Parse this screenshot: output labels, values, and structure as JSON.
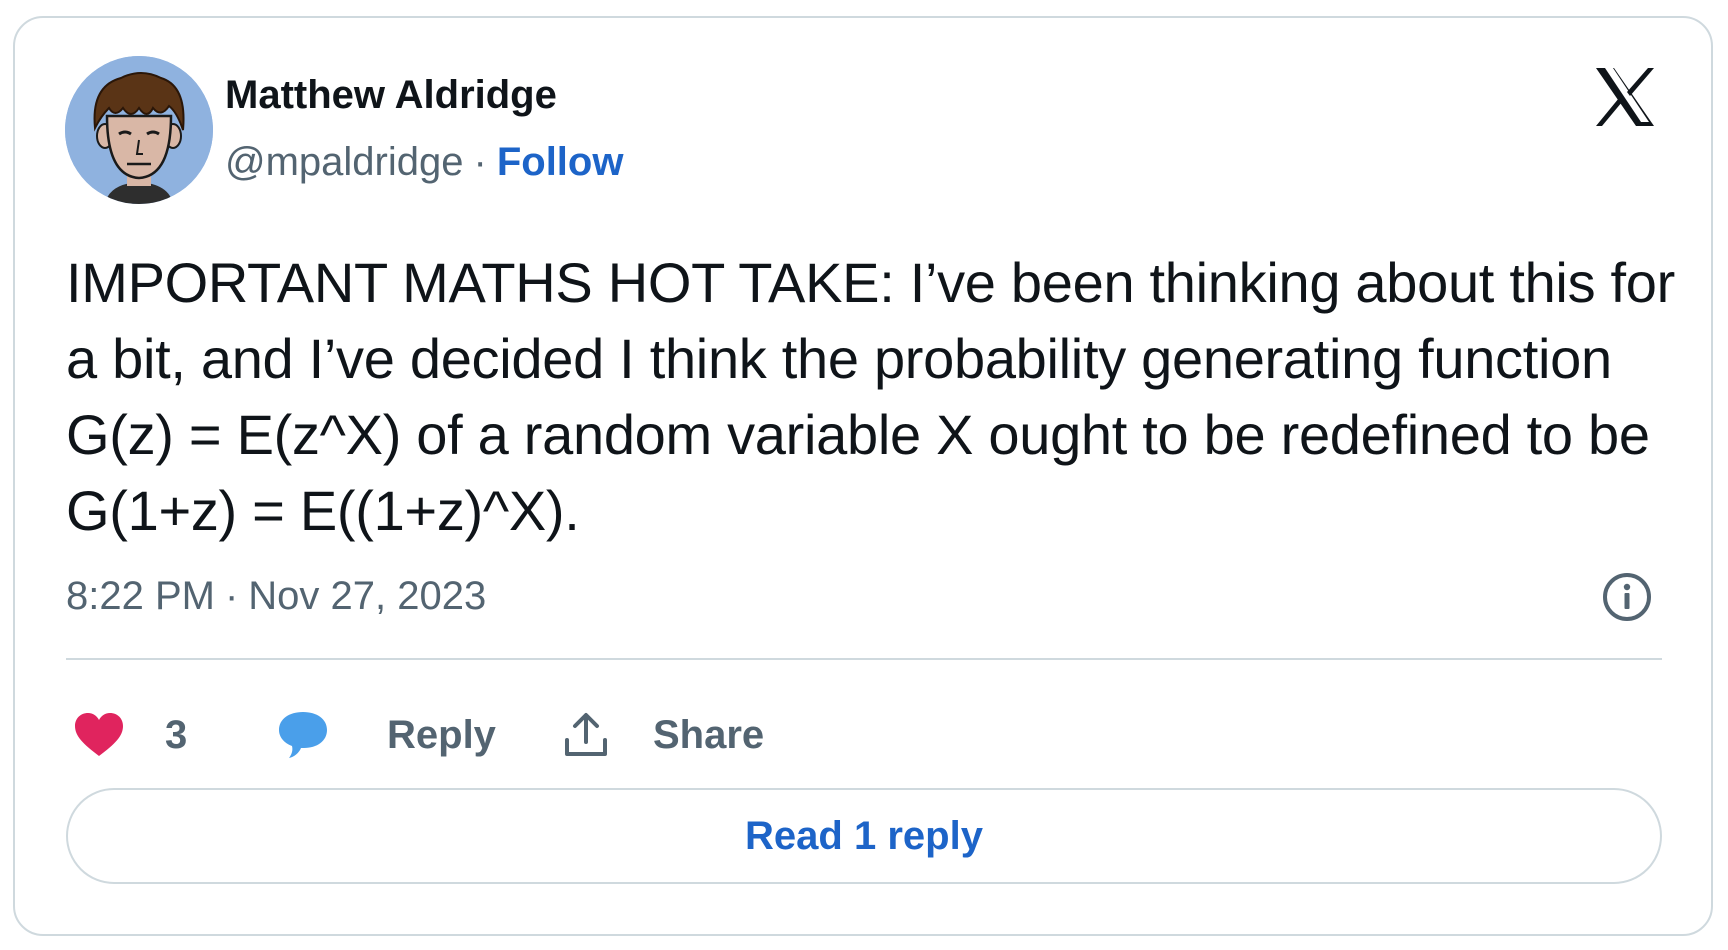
{
  "author": {
    "name": "Matthew Aldridge",
    "handle": "@mpaldridge",
    "separator": "·",
    "follow_label": "Follow"
  },
  "tweet": {
    "text": "IMPORTANT MATHS HOT TAKE: I’ve been thinking about this for a bit, and I’ve decided I think the probability generating function G(z) = E(z^X) of a random variable X ought to be redefined to be G(1+z) = E((1+z)^X).",
    "time": "8:22 PM",
    "separator": "·",
    "date": "Nov 27, 2023"
  },
  "actions": {
    "like_count": "3",
    "reply_label": "Reply",
    "share_label": "Share"
  },
  "read_replies_label": "Read 1 reply",
  "icons": {
    "brand": "x-logo-icon",
    "info": "info-icon",
    "like": "heart-icon",
    "reply": "speech-bubble-icon",
    "share": "upload-share-icon"
  },
  "colors": {
    "link_blue": "#1d64c8",
    "heart_pink": "#e0245e",
    "bubble_blue": "#4a9fea",
    "muted_gray": "#536471",
    "text_dark": "#0f1419",
    "border": "#cfd9de",
    "avatar_bg": "#8fb2df"
  }
}
